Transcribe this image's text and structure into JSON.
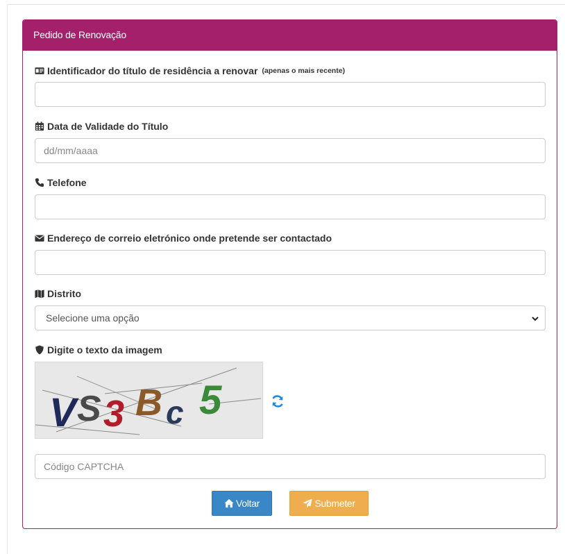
{
  "panel": {
    "title": "Pedido de Renovação"
  },
  "fields": {
    "id_title": {
      "label": "Identificador do título de residência a renovar",
      "hint": "(apenas o mais recente)",
      "value": "",
      "placeholder": ""
    },
    "validity_date": {
      "label": "Data de Validade do Título",
      "value": "",
      "placeholder": "dd/mm/aaaa"
    },
    "phone": {
      "label": "Telefone",
      "value": "",
      "placeholder": ""
    },
    "email": {
      "label": "Endereço de correio eletrónico onde pretende ser contactado",
      "value": "",
      "placeholder": ""
    },
    "district": {
      "label": "Distrito",
      "selected": "Selecione uma opção"
    },
    "captcha": {
      "label": "Digite o texto da imagem",
      "image_text": "VS3Bc5",
      "value": "",
      "placeholder": "Código CAPTCHA"
    }
  },
  "buttons": {
    "back": "Voltar",
    "submit": "Submeter"
  },
  "icons": {
    "id_title": "id-card-icon",
    "validity_date": "calendar-icon",
    "phone": "phone-icon",
    "email": "envelope-icon",
    "district": "map-icon",
    "captcha": "shield-icon",
    "refresh": "refresh-icon",
    "back": "home-icon",
    "submit": "send-icon"
  },
  "colors": {
    "accent": "#a5206a",
    "primary_button": "#3a87c8",
    "warning_button": "#f0ad4e",
    "refresh_icon": "#1e88e5"
  }
}
